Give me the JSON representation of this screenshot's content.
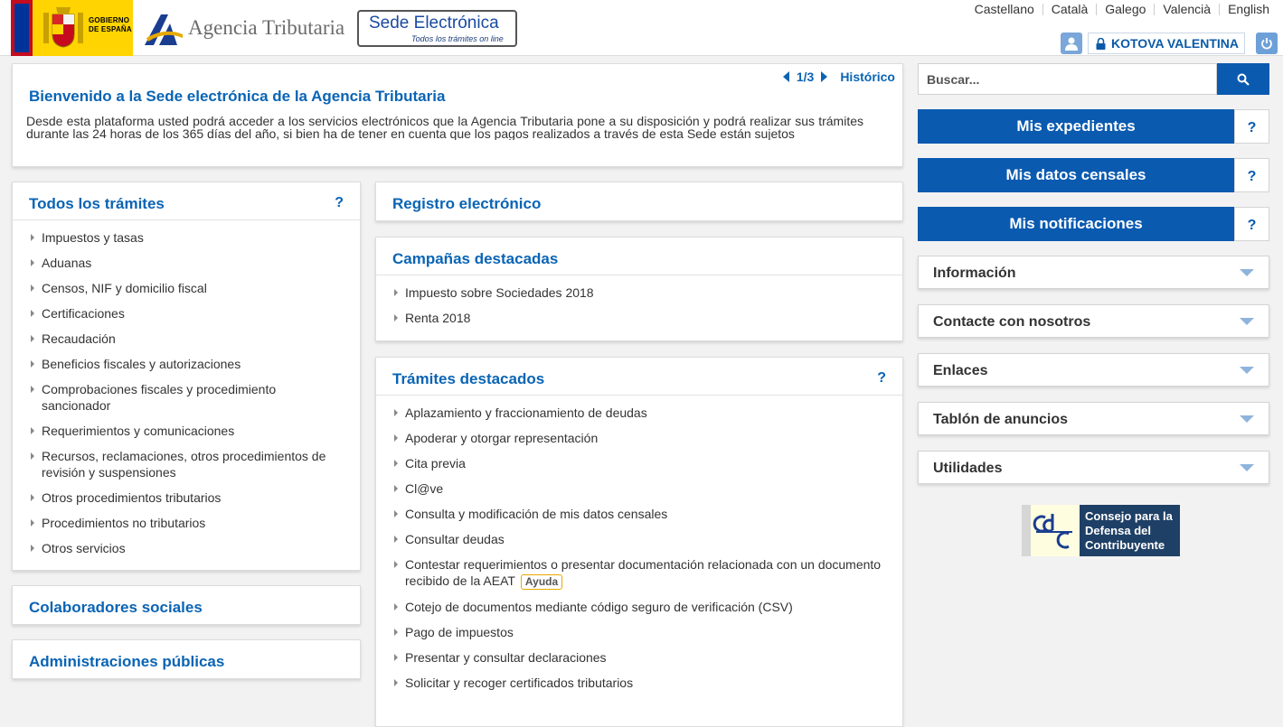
{
  "header": {
    "gov_logo_text": [
      "GOBIERNO",
      "DE ESPAÑA"
    ],
    "agency_name": "Agencia Tributaria",
    "sede_title": "Sede Electrónica",
    "sede_subtitle": "Todos los trámites on line",
    "languages": [
      "Castellano",
      "Català",
      "Galego",
      "Valencià",
      "English"
    ],
    "user_name": "KOTOVA VALENTINA"
  },
  "welcome": {
    "title": "Bienvenido a la Sede electrónica de la Agencia Tributaria",
    "body": "Desde esta plataforma usted podrá acceder a los servicios electrónicos que la Agencia Tributaria pone a su disposición y podrá realizar sus trámites durante las 24 horas de los 365 días del año, si bien ha de tener en cuenta que los pagos realizados a través de esta Sede están sujetos",
    "pager": "1/3",
    "history_link": "Histórico"
  },
  "todos": {
    "title": "Todos los trámites",
    "help": "?",
    "items": [
      "Impuestos y tasas",
      "Aduanas",
      "Censos, NIF y domicilio fiscal",
      "Certificaciones",
      "Recaudación",
      "Beneficios fiscales y autorizaciones",
      "Comprobaciones fiscales y procedimiento sancionador",
      "Requerimientos y comunicaciones",
      "Recursos, reclamaciones, otros procedimientos de revisión y suspensiones",
      "Otros procedimientos tributarios",
      "Procedimientos no tributarios",
      "Otros servicios"
    ]
  },
  "colaboradores": {
    "title": "Colaboradores sociales"
  },
  "administraciones": {
    "title": "Administraciones públicas"
  },
  "registro": {
    "title": "Registro electrónico"
  },
  "campanas": {
    "title": "Campañas destacadas",
    "items": [
      "Impuesto sobre Sociedades 2018",
      "Renta 2018"
    ]
  },
  "tramites": {
    "title": "Trámites destacados",
    "help": "?",
    "items": [
      "Aplazamiento y fraccionamiento de deudas",
      "Apoderar y otorgar representación",
      "Cita previa",
      "Cl@ve",
      "Consulta y modificación de mis datos censales",
      "Consultar deudas",
      "Contestar requerimientos o presentar documentación relacionada con un documento recibido de la AEAT",
      "Cotejo de documentos mediante código seguro de verificación (CSV)",
      "Pago de impuestos",
      "Presentar y consultar declaraciones",
      "Solicitar y recoger certificados tributarios"
    ],
    "ayuda_badge": "Ayuda"
  },
  "sidebar": {
    "search_placeholder": "Buscar...",
    "buttons": [
      "Mis expedientes",
      "Mis datos censales",
      "Mis notificaciones"
    ],
    "help": "?",
    "accordions": [
      "Información",
      "Contacte con nosotros",
      "Enlaces",
      "Tablón de anuncios",
      "Utilidades"
    ],
    "consejo_lines": [
      "Consejo para la",
      "Defensa del",
      "Contribuyente"
    ]
  },
  "colors": {
    "primary_blue": "#0a5ab0",
    "link_blue": "#0a64b4",
    "accent_yellow": "#e6a800"
  }
}
